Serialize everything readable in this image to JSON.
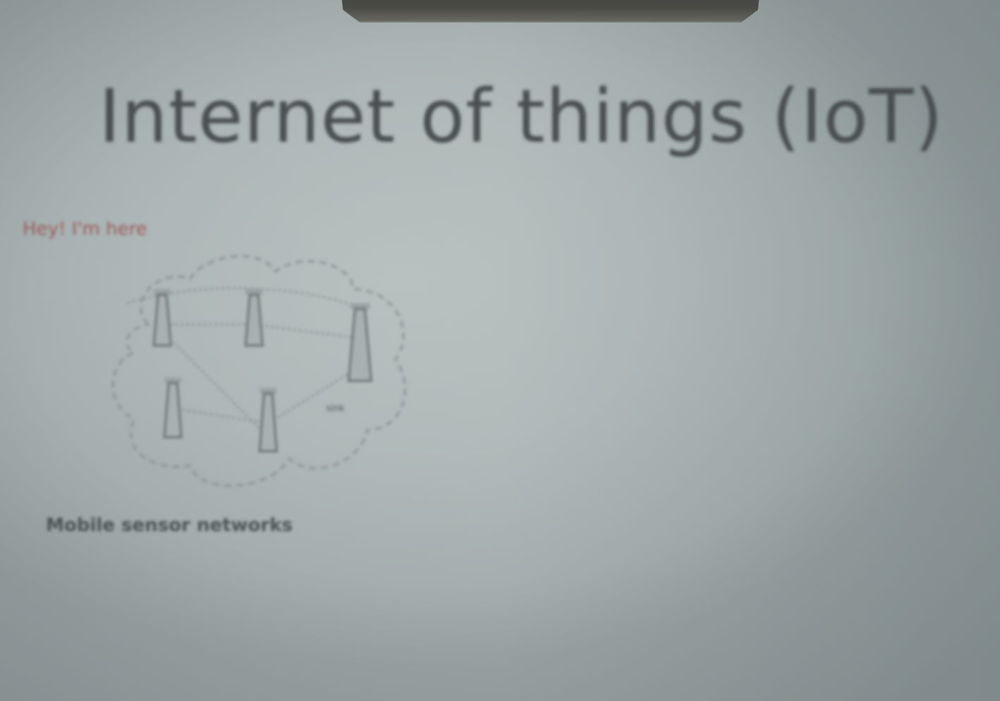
{
  "slide": {
    "title": "Internet of things (IoT)",
    "annotation": "Hey! I'm here",
    "figure": {
      "node_label": "sink",
      "caption": "Mobile sensor networks"
    }
  },
  "colors": {
    "background": "#d3d9d9",
    "title_text": "#4a4f50",
    "annotation_text": "#9c5a5c",
    "projector": "#3d3f3b"
  }
}
